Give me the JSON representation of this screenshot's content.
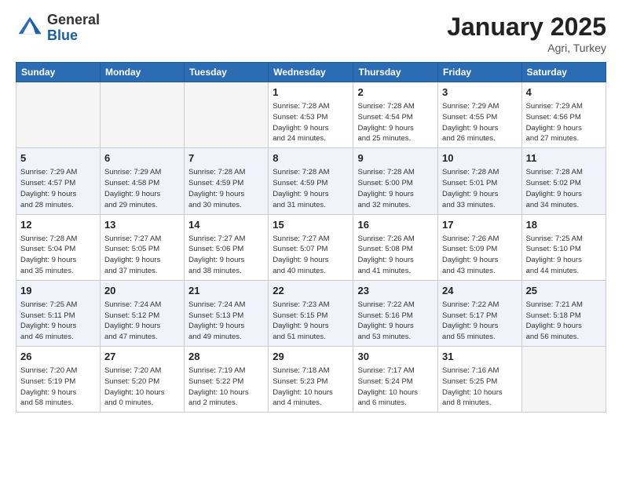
{
  "header": {
    "logo_general": "General",
    "logo_blue": "Blue",
    "month": "January 2025",
    "location": "Agri, Turkey"
  },
  "days_of_week": [
    "Sunday",
    "Monday",
    "Tuesday",
    "Wednesday",
    "Thursday",
    "Friday",
    "Saturday"
  ],
  "weeks": [
    [
      {
        "day": "",
        "info": ""
      },
      {
        "day": "",
        "info": ""
      },
      {
        "day": "",
        "info": ""
      },
      {
        "day": "1",
        "info": "Sunrise: 7:28 AM\nSunset: 4:53 PM\nDaylight: 9 hours\nand 24 minutes."
      },
      {
        "day": "2",
        "info": "Sunrise: 7:28 AM\nSunset: 4:54 PM\nDaylight: 9 hours\nand 25 minutes."
      },
      {
        "day": "3",
        "info": "Sunrise: 7:29 AM\nSunset: 4:55 PM\nDaylight: 9 hours\nand 26 minutes."
      },
      {
        "day": "4",
        "info": "Sunrise: 7:29 AM\nSunset: 4:56 PM\nDaylight: 9 hours\nand 27 minutes."
      }
    ],
    [
      {
        "day": "5",
        "info": "Sunrise: 7:29 AM\nSunset: 4:57 PM\nDaylight: 9 hours\nand 28 minutes."
      },
      {
        "day": "6",
        "info": "Sunrise: 7:29 AM\nSunset: 4:58 PM\nDaylight: 9 hours\nand 29 minutes."
      },
      {
        "day": "7",
        "info": "Sunrise: 7:28 AM\nSunset: 4:59 PM\nDaylight: 9 hours\nand 30 minutes."
      },
      {
        "day": "8",
        "info": "Sunrise: 7:28 AM\nSunset: 4:59 PM\nDaylight: 9 hours\nand 31 minutes."
      },
      {
        "day": "9",
        "info": "Sunrise: 7:28 AM\nSunset: 5:00 PM\nDaylight: 9 hours\nand 32 minutes."
      },
      {
        "day": "10",
        "info": "Sunrise: 7:28 AM\nSunset: 5:01 PM\nDaylight: 9 hours\nand 33 minutes."
      },
      {
        "day": "11",
        "info": "Sunrise: 7:28 AM\nSunset: 5:02 PM\nDaylight: 9 hours\nand 34 minutes."
      }
    ],
    [
      {
        "day": "12",
        "info": "Sunrise: 7:28 AM\nSunset: 5:04 PM\nDaylight: 9 hours\nand 35 minutes."
      },
      {
        "day": "13",
        "info": "Sunrise: 7:27 AM\nSunset: 5:05 PM\nDaylight: 9 hours\nand 37 minutes."
      },
      {
        "day": "14",
        "info": "Sunrise: 7:27 AM\nSunset: 5:06 PM\nDaylight: 9 hours\nand 38 minutes."
      },
      {
        "day": "15",
        "info": "Sunrise: 7:27 AM\nSunset: 5:07 PM\nDaylight: 9 hours\nand 40 minutes."
      },
      {
        "day": "16",
        "info": "Sunrise: 7:26 AM\nSunset: 5:08 PM\nDaylight: 9 hours\nand 41 minutes."
      },
      {
        "day": "17",
        "info": "Sunrise: 7:26 AM\nSunset: 5:09 PM\nDaylight: 9 hours\nand 43 minutes."
      },
      {
        "day": "18",
        "info": "Sunrise: 7:25 AM\nSunset: 5:10 PM\nDaylight: 9 hours\nand 44 minutes."
      }
    ],
    [
      {
        "day": "19",
        "info": "Sunrise: 7:25 AM\nSunset: 5:11 PM\nDaylight: 9 hours\nand 46 minutes."
      },
      {
        "day": "20",
        "info": "Sunrise: 7:24 AM\nSunset: 5:12 PM\nDaylight: 9 hours\nand 47 minutes."
      },
      {
        "day": "21",
        "info": "Sunrise: 7:24 AM\nSunset: 5:13 PM\nDaylight: 9 hours\nand 49 minutes."
      },
      {
        "day": "22",
        "info": "Sunrise: 7:23 AM\nSunset: 5:15 PM\nDaylight: 9 hours\nand 51 minutes."
      },
      {
        "day": "23",
        "info": "Sunrise: 7:22 AM\nSunset: 5:16 PM\nDaylight: 9 hours\nand 53 minutes."
      },
      {
        "day": "24",
        "info": "Sunrise: 7:22 AM\nSunset: 5:17 PM\nDaylight: 9 hours\nand 55 minutes."
      },
      {
        "day": "25",
        "info": "Sunrise: 7:21 AM\nSunset: 5:18 PM\nDaylight: 9 hours\nand 56 minutes."
      }
    ],
    [
      {
        "day": "26",
        "info": "Sunrise: 7:20 AM\nSunset: 5:19 PM\nDaylight: 9 hours\nand 58 minutes."
      },
      {
        "day": "27",
        "info": "Sunrise: 7:20 AM\nSunset: 5:20 PM\nDaylight: 10 hours\nand 0 minutes."
      },
      {
        "day": "28",
        "info": "Sunrise: 7:19 AM\nSunset: 5:22 PM\nDaylight: 10 hours\nand 2 minutes."
      },
      {
        "day": "29",
        "info": "Sunrise: 7:18 AM\nSunset: 5:23 PM\nDaylight: 10 hours\nand 4 minutes."
      },
      {
        "day": "30",
        "info": "Sunrise: 7:17 AM\nSunset: 5:24 PM\nDaylight: 10 hours\nand 6 minutes."
      },
      {
        "day": "31",
        "info": "Sunrise: 7:16 AM\nSunset: 5:25 PM\nDaylight: 10 hours\nand 8 minutes."
      },
      {
        "day": "",
        "info": ""
      }
    ]
  ]
}
